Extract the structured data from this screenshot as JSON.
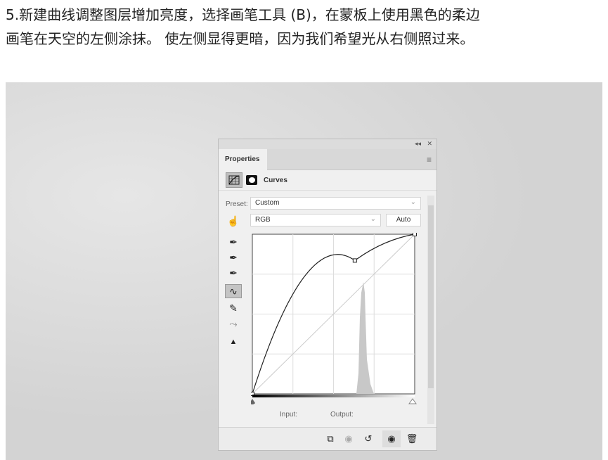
{
  "caption": {
    "line1": "5.新建曲线调整图层增加亮度，选择画笔工具 (B)，在蒙板上使用黑色的柔边",
    "line2": "画笔在天空的左侧涂抹。 使左侧显得更暗，因为我们希望光从右侧照过来。"
  },
  "panel": {
    "tab": "Properties",
    "adjustment": "Curves",
    "preset_label": "Preset:",
    "preset_value": "Custom",
    "channel_value": "RGB",
    "auto_label": "Auto",
    "input_label": "Input:",
    "output_label": "Output:",
    "collapse": "◂◂",
    "close": "✕"
  },
  "curve": {
    "points": [
      [
        0,
        0
      ],
      [
        161,
        213
      ],
      [
        255,
        255
      ]
    ],
    "range": [
      0,
      255
    ]
  },
  "icons": [
    "curves-grid-icon",
    "mask-icon",
    "menu-icon",
    "target-adjust-icon",
    "eyedropper-black-icon",
    "eyedropper-gray-icon",
    "eyedropper-white-icon",
    "curve-point-tool-icon",
    "pencil-icon",
    "smooth-icon",
    "clipping-warning-icon",
    "clip-to-layer-icon",
    "view-previous-icon",
    "reset-icon",
    "visibility-icon",
    "trash-icon"
  ]
}
